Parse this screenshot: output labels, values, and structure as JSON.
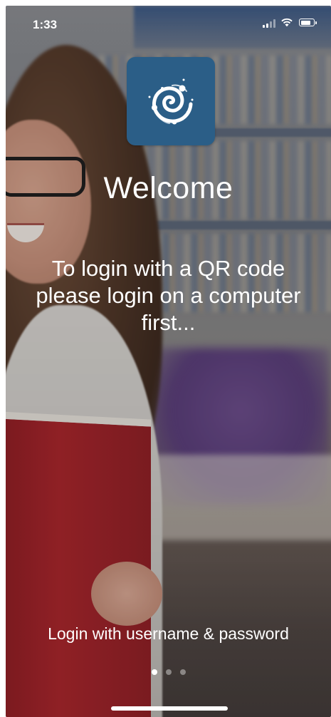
{
  "status_bar": {
    "time": "1:33",
    "signal_icon": "cellular-signal-icon",
    "wifi_icon": "wifi-icon",
    "battery_icon": "battery-icon",
    "battery_level": 0.85
  },
  "logo": {
    "icon": "spiral-galaxy-logo-icon",
    "background_color": "#2b5e87"
  },
  "welcome": {
    "title": "Welcome",
    "instructions": "To login with a QR code please login on a computer first..."
  },
  "actions": {
    "username_login_label": "Login with username & password"
  },
  "pager": {
    "page_count": 3,
    "current_page": 1
  }
}
